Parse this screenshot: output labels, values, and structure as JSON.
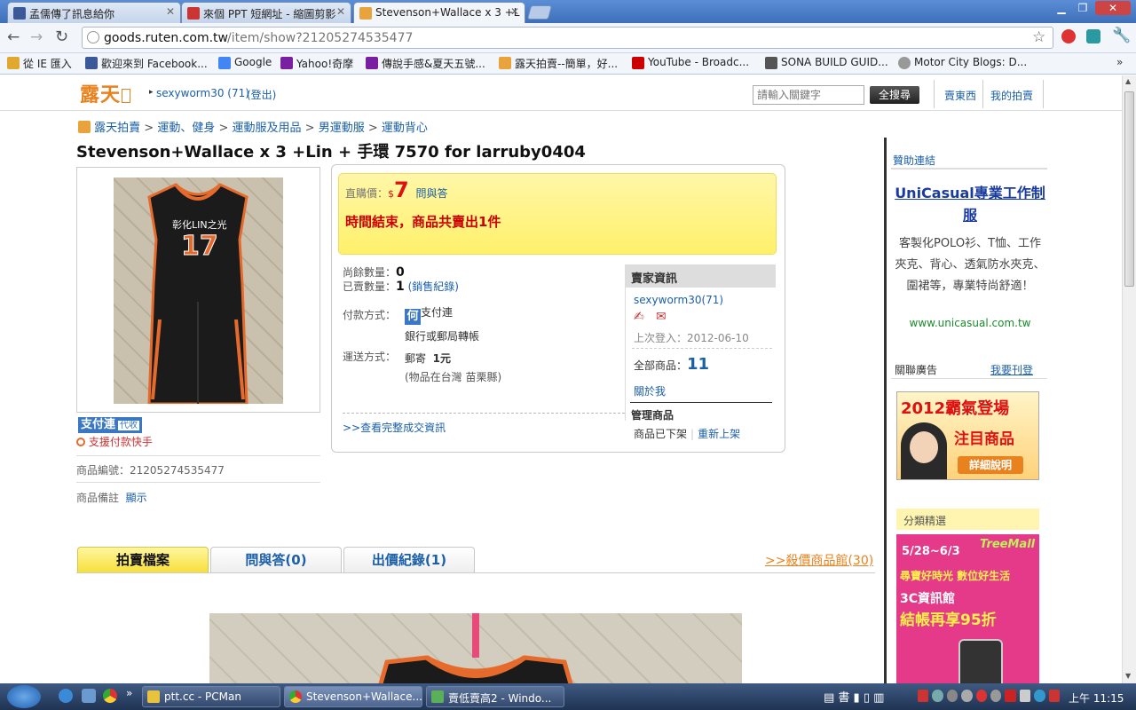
{
  "browser": {
    "tabs": [
      {
        "label": "孟儒傳了訊息給你",
        "fav_color": "#3b5998"
      },
      {
        "label": "來個 PPT 短網址 - 縮圖剪影",
        "fav_color": "#cc3333"
      },
      {
        "label": "Stevenson+Wallace x 3 +L",
        "fav_color": "#e8a33d"
      }
    ],
    "new_tab_label": "",
    "url_host": "goods.ruten.com.tw",
    "url_path": "/item/show?21205274535477",
    "bookmarks": [
      {
        "label": "從 IE 匯入",
        "color": "#e0a82e"
      },
      {
        "label": "歡迎來到 Facebook...",
        "color": "#3b5998"
      },
      {
        "label": "Google",
        "color": "#4285f4"
      },
      {
        "label": "Yahoo!奇摩",
        "color": "#7b1fa2"
      },
      {
        "label": "傳說手感&夏天五號...",
        "color": "#7b1fa2"
      },
      {
        "label": "露天拍賣--簡單，好...",
        "color": "#e8a33d"
      },
      {
        "label": "YouTube - Broadc...",
        "color": "#cc0000"
      },
      {
        "label": "SONA BUILD GUID...",
        "color": "#555555"
      },
      {
        "label": "Motor City Blogs: D...",
        "color": "#999999"
      }
    ],
    "bookmarks_overflow": "»"
  },
  "site": {
    "logo": "露天",
    "user_link": "sexyworm30 (71)",
    "logout": "(登出)",
    "search_placeholder": "請輸入關鍵字",
    "search_button": "全搜尋",
    "top_links": [
      "賣東西",
      "我的拍賣"
    ]
  },
  "breadcrumb": [
    "露天拍賣",
    "運動、健身",
    "運動服及用品",
    "男運動服",
    "運動背心"
  ],
  "product": {
    "title": "Stevenson+Wallace x 3 +Lin + 手環 7570 for larruby0404",
    "jersey_text": "彰化LIN之光",
    "jersey_number": "17",
    "paid_badge": "支付連",
    "paid_badge_sub": "代收",
    "support_label": "支援付款快手",
    "item_id_label": "商品編號：",
    "item_id": "21205274535477",
    "note_label": "商品備註",
    "note_link": "顯示",
    "price_label": "直購價：",
    "currency": "$",
    "price": "7",
    "qa_link": "問與答",
    "end_text": "時間結束，商品共賣出1件",
    "remaining_label": "尚餘數量：",
    "remaining": "0",
    "sold_label": "已賣數量：",
    "sold": "1",
    "sales_record": "(銷售紀錄)",
    "pay_label": "付款方式：",
    "pay_methods": [
      "支付連",
      "銀行或郵局轉帳"
    ],
    "ship_label": "運送方式：",
    "ship_method": "郵寄",
    "ship_price": "1元",
    "ship_location": "(物品在台灣 苗栗縣)",
    "transactions_link": ">>查看完整成交資訊",
    "seller_header": "賣家資訊",
    "seller_name": "sexyworm30(71)",
    "last_login_label": "上次登入：",
    "last_login": "2012-06-10",
    "all_items_label": "全部商品：",
    "all_items": "11",
    "about_link": "關於我",
    "manage_header": "管理商品",
    "manage_status": "商品已下架",
    "relist_link": "重新上架"
  },
  "tabs": {
    "items": [
      "拍賣檔案",
      "問與答(0)",
      "出價紀錄(1)"
    ],
    "bargain_link": ">>殺價商品館(30)"
  },
  "sidebar": {
    "sponsor_title": "贊助連結",
    "ad_title": "UniCasual專業工作制服",
    "ad_text": "客製化POLO衫、T恤、工作夾克、背心、透氣防水夾克、圍裙等，專業特尚舒適！",
    "ad_url": "www.unicasual.com.tw",
    "related_ads": "關聯廣告",
    "post_ad": "我要刊登",
    "banner1_line1": "2012霸氣登場",
    "banner1_line2": "注目商品",
    "banner1_btn": "詳細說明",
    "category_title": "分類精選",
    "banner2_date": "5/28~6/3",
    "banner2_brand": "TreeMall",
    "banner2_line1": "尋寶好時光 數位好生活",
    "banner2_line2": "3C資訊館",
    "banner2_line3": "結帳再享95折"
  },
  "taskbar": {
    "tasks": [
      "ptt.cc - PCMan",
      "Stevenson+Wallace...",
      "賣低賣高2 - Windo..."
    ],
    "clock": "上午 11:15"
  }
}
